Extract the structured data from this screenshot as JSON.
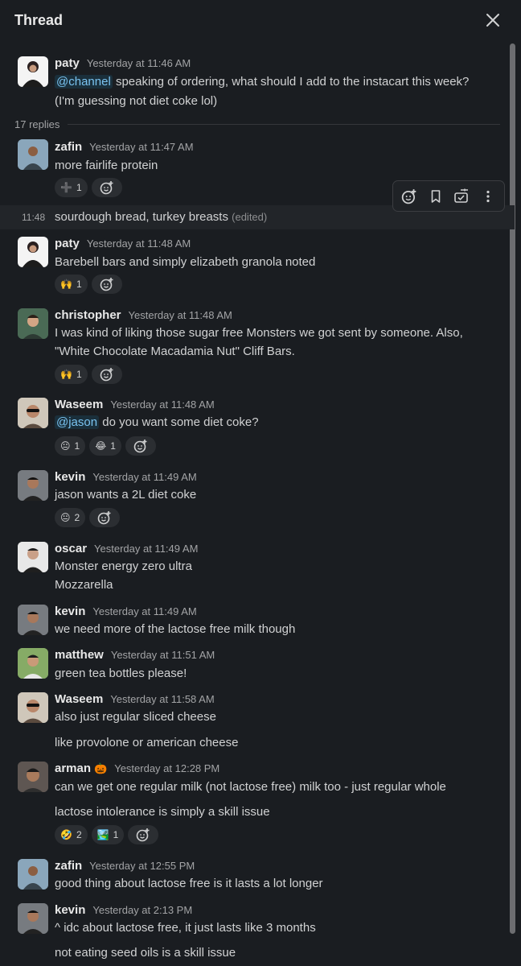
{
  "header": {
    "title": "Thread"
  },
  "parent": {
    "author": "paty",
    "time": "Yesterday at 11:46 AM",
    "mention": "@channel",
    "line1": " speaking of ordering, what should I add to the instacart this week?",
    "line2": "(I'm guessing not diet coke lol)"
  },
  "replies_label": "17 replies",
  "messages": [
    {
      "author": "zafin",
      "time": "Yesterday at 11:47 AM",
      "lines": [
        "more fairlife protein"
      ],
      "reactions": [
        {
          "emoji": "➕",
          "count": "1"
        }
      ]
    },
    {
      "time": "11:48",
      "text": "sourdough bread, turkey breasts",
      "edited": "(edited)"
    },
    {
      "author": "paty",
      "time": "Yesterday at 11:48 AM",
      "lines": [
        "Barebell bars and simply elizabeth granola noted"
      ],
      "reactions": [
        {
          "emoji": "🙌",
          "count": "1"
        }
      ]
    },
    {
      "author": "christopher",
      "time": "Yesterday at 11:48 AM",
      "lines": [
        "I was kind of liking those sugar free Monsters we got sent by someone. Also,",
        "\"White Chocolate Macadamia Nut\" Cliff Bars."
      ],
      "reactions": [
        {
          "emoji": "🙌",
          "count": "1"
        }
      ]
    },
    {
      "author": "Waseem",
      "time": "Yesterday at 11:48 AM",
      "mention": "@jason",
      "lines": [
        " do you want some diet coke?"
      ],
      "reactions": [
        {
          "emoji": "😐",
          "count": "1"
        },
        {
          "emoji": "😂",
          "count": "1"
        }
      ]
    },
    {
      "author": "kevin",
      "time": "Yesterday at 11:49 AM",
      "lines": [
        "jason wants a 2L diet coke"
      ],
      "reactions": [
        {
          "emoji": "😐",
          "count": "2"
        }
      ]
    },
    {
      "author": "oscar",
      "time": "Yesterday at 11:49 AM",
      "lines": [
        "Monster energy zero ultra",
        "Mozzarella"
      ]
    },
    {
      "author": "kevin",
      "time": "Yesterday at 11:49 AM",
      "lines": [
        "we need more of the lactose free milk though"
      ]
    },
    {
      "author": "matthew",
      "time": "Yesterday at 11:51 AM",
      "lines": [
        "green tea bottles please!"
      ]
    },
    {
      "author": "Waseem",
      "time": "Yesterday at 11:58 AM",
      "lines": [
        "also just regular sliced cheese",
        "like provolone or american cheese"
      ]
    },
    {
      "author": "arman",
      "status_emoji": "🎃",
      "time": "Yesterday at 12:28 PM",
      "lines": [
        "can we get one regular milk (not lactose free) milk too - just regular whole",
        "lactose intolerance is simply a skill issue"
      ],
      "reactions": [
        {
          "emoji": "🤣",
          "count": "2"
        },
        {
          "emoji": "🏞️",
          "count": "1"
        }
      ]
    },
    {
      "author": "zafin",
      "time": "Yesterday at 12:55 PM",
      "lines": [
        "good thing about lactose free is it lasts a lot longer"
      ]
    },
    {
      "author": "kevin",
      "time": "Yesterday at 2:13 PM",
      "lines": [
        "^ idc about lactose free, it just lasts like 3 months",
        "not eating seed oils is a skill issue"
      ]
    }
  ],
  "icons": {
    "close": "close-icon",
    "add_reaction": "add-reaction-icon",
    "bookmark": "bookmark-icon",
    "forward": "forward-icon",
    "more": "more-vertical-icon"
  },
  "colors": {
    "background": "#1a1d21",
    "mention": "#7ac3f0",
    "reaction_bg": "#2b2e32"
  }
}
